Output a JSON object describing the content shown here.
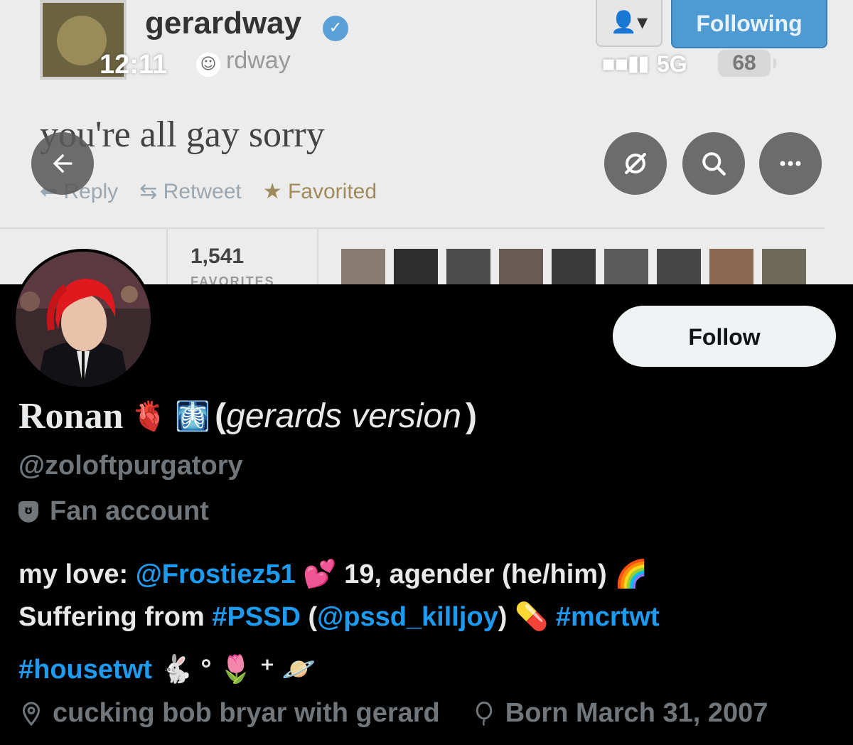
{
  "banner": {
    "tweet_name": "gerardway",
    "tweet_handle_partial": "rdway",
    "user_menu": "👤▾",
    "following_label": "Following",
    "tweet_text": "you're all gay sorry",
    "reply_label": "Reply",
    "retweet_label": "Retweet",
    "favorited_label": "Favorited",
    "favorites_count": "1,541",
    "favorites_label": "FAVORITES"
  },
  "status_bar": {
    "time": "12:11",
    "network": "5G",
    "battery": "68"
  },
  "profile": {
    "name": "Ronan",
    "name_emojis": "🫀 🩻",
    "name_suffix_open": "(",
    "name_suffix": "gerards version",
    "name_suffix_close": ")",
    "handle": "@zoloftpurgatory",
    "label": "Fan account",
    "follow_label": "Follow",
    "bio": {
      "l1_a": "my love: ",
      "l1_link": "@Frostiez51",
      "l1_b": " 💕  19, agender (he/him) 🌈",
      "l2_a": "Suffering from ",
      "l2_tag": "#PSSD",
      "l2_b": " (",
      "l2_link": "@pssd_killjoy",
      "l2_c": ") 💊  ",
      "l2_tag2": "#mcrtwt",
      "l3_tag": "#housetwt",
      "l3_b": " 🐇 ° 🌷 ⁺ 🪐"
    },
    "location": "cucking bob bryar with gerard",
    "born": "Born March 31, 2007"
  },
  "icons": {
    "back": "arrow-left-icon",
    "no_translate": "slash-circle-icon",
    "search": "search-icon",
    "more": "more-icon",
    "location": "location-pin-icon",
    "born": "balloon-icon",
    "label": "mask-icon"
  },
  "colors": {
    "link": "#1d9bf0",
    "muted": "#71767b",
    "text": "#e7e9ea",
    "background": "#000000"
  }
}
